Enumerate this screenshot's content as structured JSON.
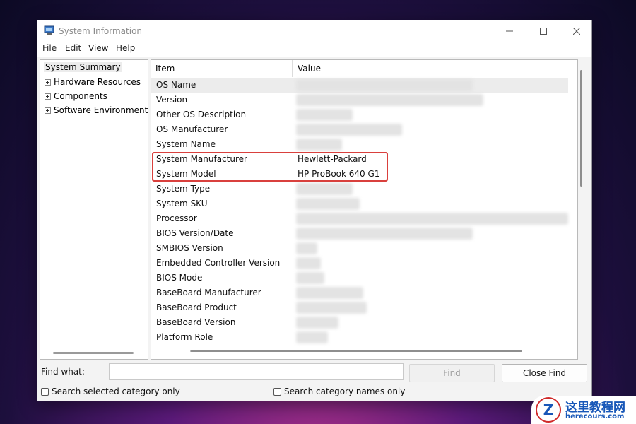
{
  "window": {
    "title": "System Information"
  },
  "menu": [
    "File",
    "Edit",
    "View",
    "Help"
  ],
  "tree": {
    "root": "System Summary",
    "items": [
      "Hardware Resources",
      "Components",
      "Software Environment"
    ]
  },
  "grid": {
    "columns": {
      "item": "Item",
      "value": "Value"
    },
    "rows": [
      {
        "item": "OS Name",
        "value": ""
      },
      {
        "item": "Version",
        "value": ""
      },
      {
        "item": "Other OS Description",
        "value": ""
      },
      {
        "item": "OS Manufacturer",
        "value": ""
      },
      {
        "item": "System Name",
        "value": ""
      },
      {
        "item": "System Manufacturer",
        "value": "Hewlett-Packard"
      },
      {
        "item": "System Model",
        "value": "HP ProBook 640 G1"
      },
      {
        "item": "System Type",
        "value": ""
      },
      {
        "item": "System SKU",
        "value": ""
      },
      {
        "item": "Processor",
        "value": ""
      },
      {
        "item": "BIOS Version/Date",
        "value": ""
      },
      {
        "item": "SMBIOS Version",
        "value": ""
      },
      {
        "item": "Embedded Controller Version",
        "value": ""
      },
      {
        "item": "BIOS Mode",
        "value": ""
      },
      {
        "item": "BaseBoard Manufacturer",
        "value": ""
      },
      {
        "item": "BaseBoard Product",
        "value": ""
      },
      {
        "item": "BaseBoard Version",
        "value": ""
      },
      {
        "item": "Platform Role",
        "value": ""
      }
    ]
  },
  "find": {
    "label": "Find what:",
    "value": "",
    "find_button": "Find",
    "close_button": "Close Find",
    "option_selected": "Search selected category only",
    "option_names": "Search category names only"
  },
  "watermark": {
    "brand": "这里教程网",
    "url": "herecours.com"
  },
  "colors": {
    "highlight": "#d9403d",
    "brand": "#1857b8"
  }
}
